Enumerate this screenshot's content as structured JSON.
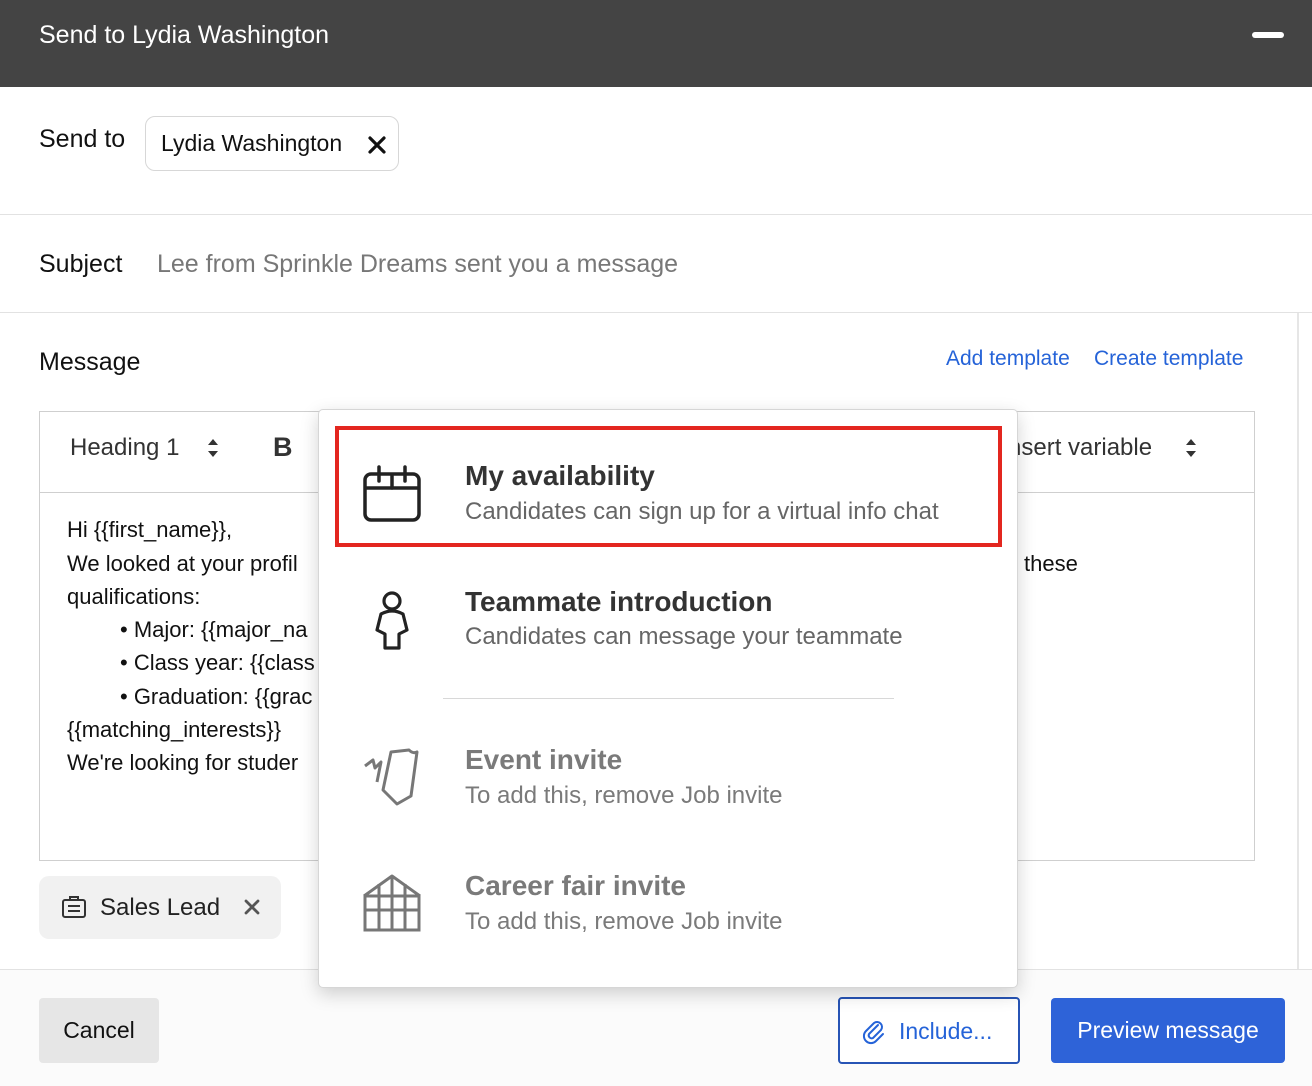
{
  "window": {
    "title": "Send to Lydia Washington"
  },
  "send_to": {
    "label": "Send to",
    "recipient": "Lydia Washington"
  },
  "subject": {
    "label": "Subject",
    "value": "Lee from Sprinkle Dreams sent you a message"
  },
  "message": {
    "label": "Message",
    "add_template": "Add template",
    "create_template": "Create template",
    "toolbar": {
      "heading_select": "Heading 1",
      "bold": "B",
      "insert_variable": "nsert variable"
    },
    "body": {
      "line1": "Hi {{first_name}},",
      "line2a": "We looked at your profil",
      "line2b": "these",
      "line3": "qualifications:",
      "bullet1": "• Major: {{major_na",
      "bullet2": "• Class year: {{class",
      "bullet3": "• Graduation: {{grac",
      "line4": "{{matching_interests}}",
      "line5": "We're looking for studer"
    }
  },
  "tag": {
    "label": "Sales Lead"
  },
  "footer": {
    "cancel": "Cancel",
    "include": "Include...",
    "preview": "Preview message"
  },
  "include_menu": {
    "options": [
      {
        "title": "My availability",
        "subtitle": "Candidates can sign up for a virtual info chat",
        "icon": "calendar-icon",
        "enabled": true,
        "highlighted": true
      },
      {
        "title": "Teammate introduction",
        "subtitle": "Candidates can message your teammate",
        "icon": "person-icon",
        "enabled": true
      },
      {
        "title": "Event invite",
        "subtitle": "To add this, remove Job invite",
        "icon": "tickets-icon",
        "enabled": false
      },
      {
        "title": "Career fair invite",
        "subtitle": "To add this, remove Job invite",
        "icon": "building-icon",
        "enabled": false
      }
    ]
  },
  "colors": {
    "titlebar": "#444444",
    "accent_blue": "#2e63d8",
    "link_blue": "#2563d8",
    "highlight_red": "#e3261f"
  }
}
